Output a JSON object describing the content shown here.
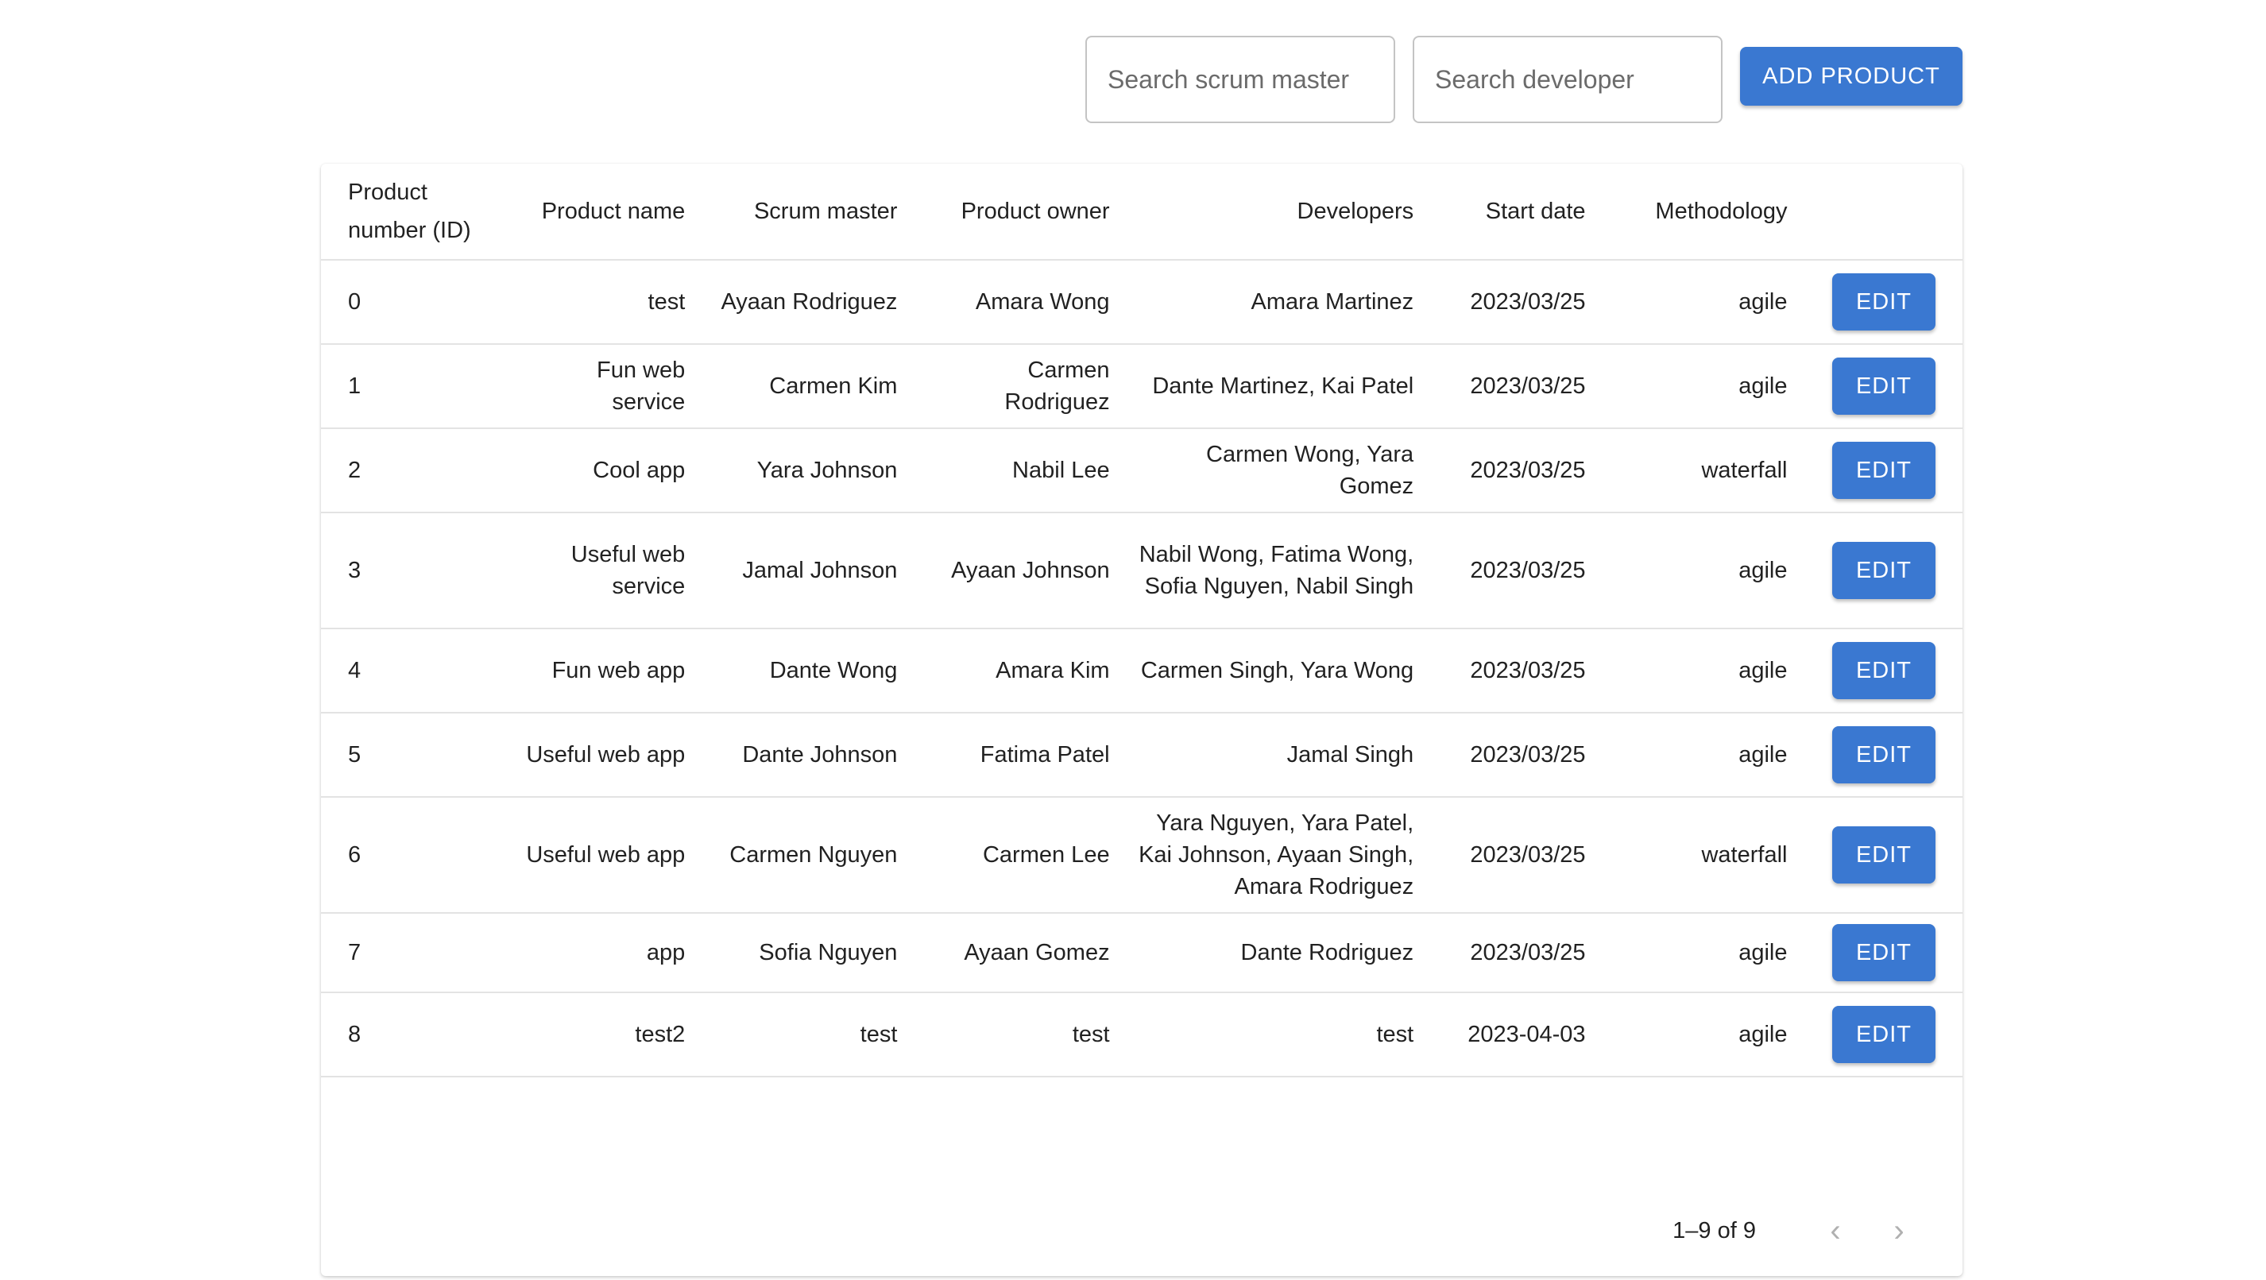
{
  "search": {
    "scrum_placeholder": "Search scrum master",
    "developer_placeholder": "Search developer"
  },
  "toolbar": {
    "add_label": "ADD PRODUCT"
  },
  "table": {
    "headers": [
      "Product number (ID)",
      "Product name",
      "Scrum master",
      "Product owner",
      "Developers",
      "Start date",
      "Methodology"
    ],
    "rows": [
      {
        "id": "0",
        "name": "test",
        "scrum": "Ayaan Rodriguez",
        "owner": "Amara Wong",
        "devs": "Amara Martinez",
        "date": "2023/03/25",
        "method": "agile",
        "edit": "EDIT"
      },
      {
        "id": "1",
        "name": "Fun web service",
        "scrum": "Carmen Kim",
        "owner": "Carmen Rodriguez",
        "devs": "Dante Martinez, Kai Patel",
        "date": "2023/03/25",
        "method": "agile",
        "edit": "EDIT"
      },
      {
        "id": "2",
        "name": "Cool app",
        "scrum": "Yara Johnson",
        "owner": "Nabil Lee",
        "devs": "Carmen Wong, Yara Gomez",
        "date": "2023/03/25",
        "method": "waterfall",
        "edit": "EDIT"
      },
      {
        "id": "3",
        "name": "Useful web service",
        "scrum": "Jamal Johnson",
        "owner": "Ayaan Johnson",
        "devs": "Nabil Wong, Fatima Wong, Sofia Nguyen, Nabil Singh",
        "date": "2023/03/25",
        "method": "agile",
        "edit": "EDIT"
      },
      {
        "id": "4",
        "name": "Fun web app",
        "scrum": "Dante Wong",
        "owner": "Amara Kim",
        "devs": "Carmen Singh, Yara Wong",
        "date": "2023/03/25",
        "method": "agile",
        "edit": "EDIT"
      },
      {
        "id": "5",
        "name": "Useful web app",
        "scrum": "Dante Johnson",
        "owner": "Fatima Patel",
        "devs": "Jamal Singh",
        "date": "2023/03/25",
        "method": "agile",
        "edit": "EDIT"
      },
      {
        "id": "6",
        "name": "Useful web app",
        "scrum": "Carmen Nguyen",
        "owner": "Carmen Lee",
        "devs": "Yara Nguyen, Yara Patel, Kai Johnson, Ayaan Singh, Amara Rodriguez",
        "date": "2023/03/25",
        "method": "waterfall",
        "edit": "EDIT"
      },
      {
        "id": "7",
        "name": "app",
        "scrum": "Sofia Nguyen",
        "owner": "Ayaan Gomez",
        "devs": "Dante Rodriguez",
        "date": "2023/03/25",
        "method": "agile",
        "edit": "EDIT"
      },
      {
        "id": "8",
        "name": "test2",
        "scrum": "test",
        "owner": "test",
        "devs": "test",
        "date": "2023-04-03",
        "method": "agile",
        "edit": "EDIT"
      }
    ]
  },
  "pagination": {
    "label": "1–9 of 9",
    "prev_icon": "chevron-left-icon",
    "next_icon": "chevron-right-icon"
  },
  "colors": {
    "accent": "#3a78d1",
    "border": "#e3e3e3"
  }
}
